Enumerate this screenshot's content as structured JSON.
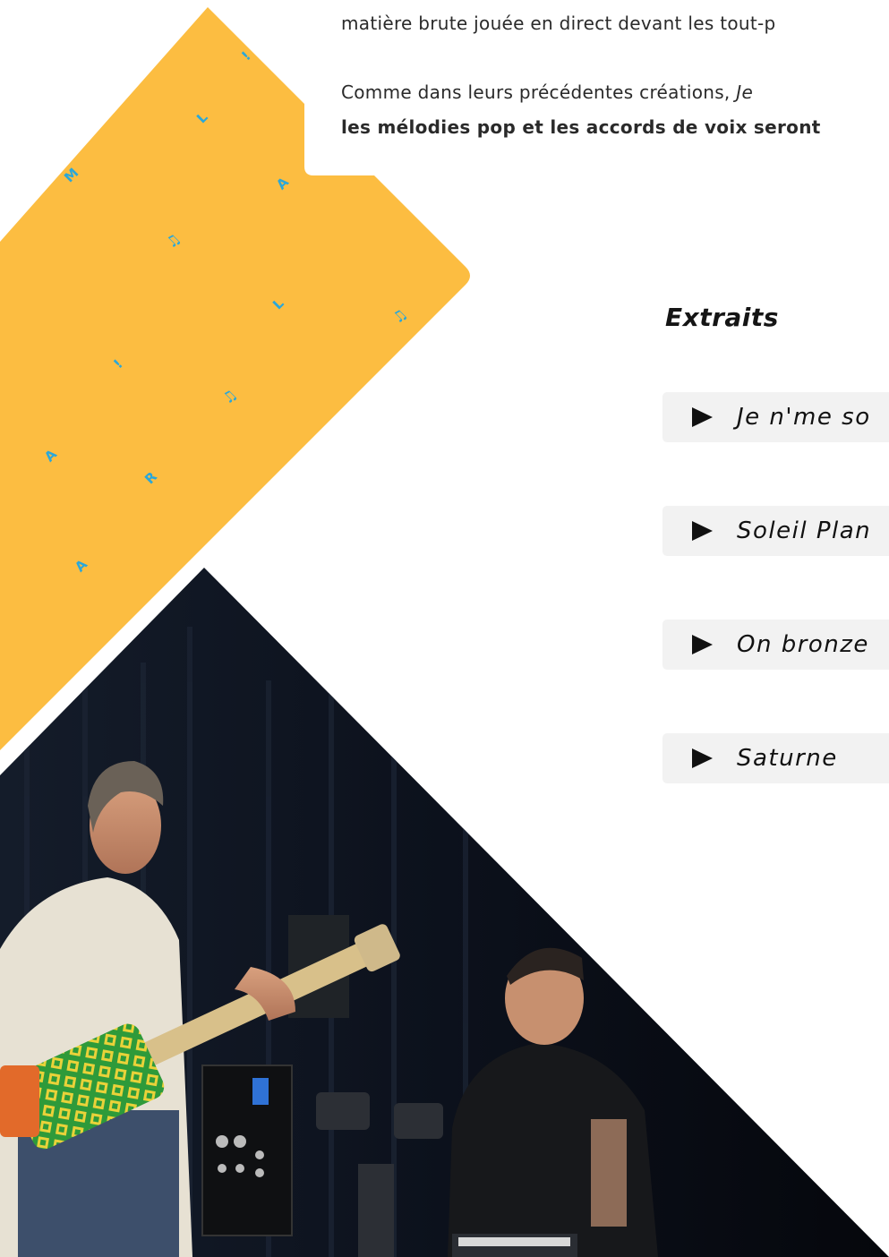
{
  "text": {
    "line1": "matière brute jouée en direct devant les tout-p",
    "line2_plain": "Comme dans leurs précédentes créations, ",
    "line2_em": "Je",
    "line3": "les mélodies pop et les accords de voix seront"
  },
  "logo_letters": [
    "M",
    "L",
    "!",
    "A",
    "L",
    "!",
    "A",
    "R",
    "A"
  ],
  "extraits": {
    "title": "Extraits",
    "tracks": [
      {
        "title": "Je n'me so"
      },
      {
        "title": "Soleil Plan"
      },
      {
        "title": "On bronze"
      },
      {
        "title": "Saturne"
      }
    ]
  },
  "colors": {
    "yellow": "#fcbd41",
    "letters": "#2aa7d9",
    "track_bg": "#f2f2f2"
  },
  "icons": [
    "play-icon",
    "music-note-icon"
  ]
}
